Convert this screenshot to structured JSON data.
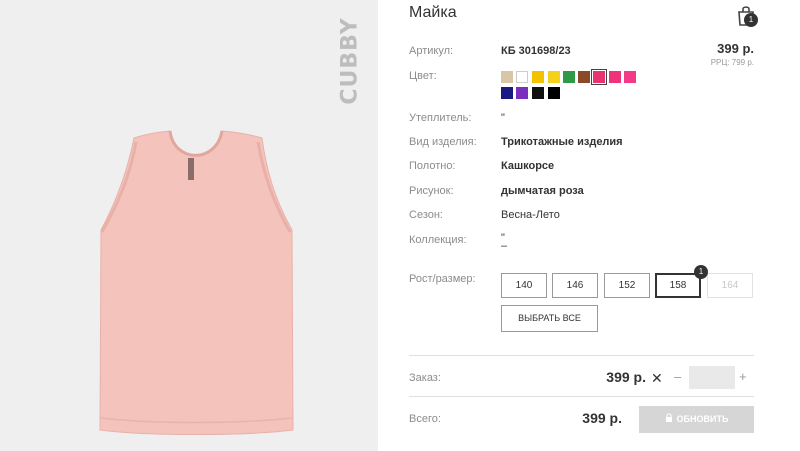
{
  "product": {
    "brand": "CUBBY",
    "title": "Майка",
    "cart_count": "1"
  },
  "details": {
    "article_label": "Артикул:",
    "article_value": "КБ 301698/23",
    "price": "399 р.",
    "rrc": "РРЦ: 799 р.",
    "color_label": "Цвет:",
    "insulation_label": "Утеплитель:",
    "insulation_value": "\"",
    "type_label": "Вид изделия:",
    "type_value": "Трикотажные изделия",
    "fabric_label": "Полотно:",
    "fabric_value": "Кашкорсе",
    "pattern_label": "Рисунок:",
    "pattern_value": "дымчатая роза",
    "season_label": "Сезон:",
    "season_value": "Весна-Лето",
    "collection_label": "Коллекция:",
    "collection_value": "\"",
    "collection_value2": "–"
  },
  "colors": [
    "#d9c6a5",
    "#ffffff",
    "#f2c200",
    "#f4d21c",
    "#2e9a48",
    "#8a4a2a",
    "#e8336f",
    "#f0327a",
    "#f23a86",
    "#1a1a80",
    "#7b2fbf",
    "#111111",
    "#000000"
  ],
  "sizes": {
    "label": "Рост/размер:",
    "options": [
      "140",
      "146",
      "152",
      "158",
      "164"
    ],
    "selected_badge": "1",
    "select_all": "ВЫБРАТЬ ВСЕ"
  },
  "order": {
    "label": "Заказ:",
    "price": "399 р.",
    "times": "✕",
    "minus": "–",
    "plus": "+",
    "qty_value": ""
  },
  "total": {
    "label": "Всего:",
    "price": "399 р.",
    "update": "ОБНОВИТЬ"
  }
}
